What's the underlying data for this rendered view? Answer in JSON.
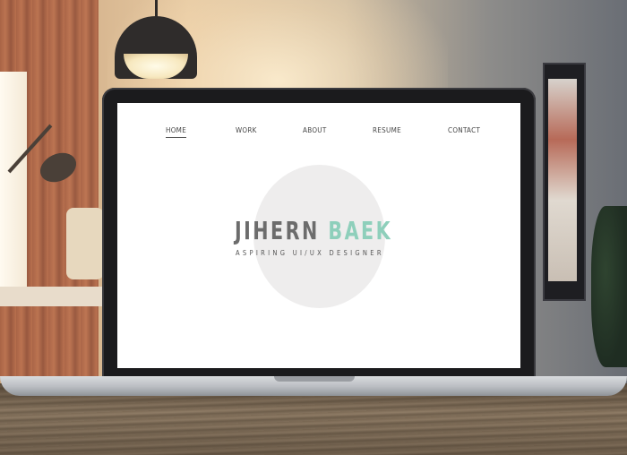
{
  "nav": {
    "items": [
      {
        "label": "HOME",
        "active": true
      },
      {
        "label": "WORK",
        "active": false
      },
      {
        "label": "ABOUT",
        "active": false
      },
      {
        "label": "RESUME",
        "active": false
      },
      {
        "label": "CONTACT",
        "active": false
      }
    ]
  },
  "hero": {
    "first_name": "JIHERN",
    "last_name": "BAEK",
    "tagline": "ASPIRING UI/UX DESIGNER"
  },
  "colors": {
    "name_primary": "#6c6c6c",
    "name_accent": "#8ecfbb",
    "hero_circle": "#eeeded",
    "screen_background": "#ffffff"
  }
}
